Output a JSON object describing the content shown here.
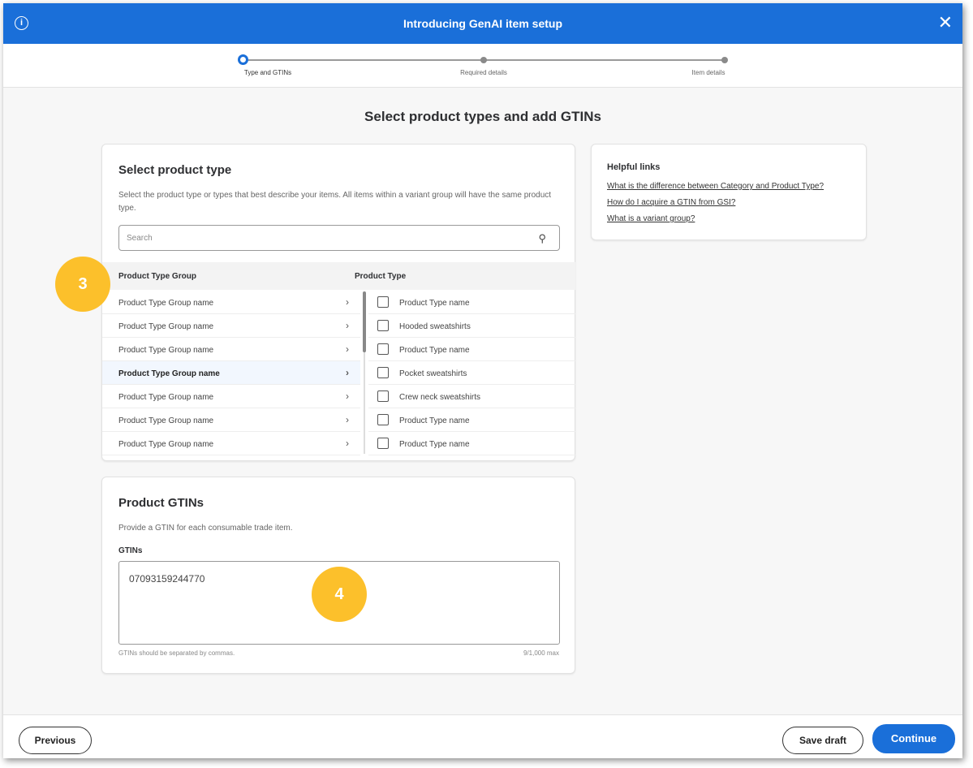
{
  "header": {
    "title": "Introducing GenAI item setup",
    "info_icon": "i",
    "close_icon": "✕"
  },
  "steps": [
    {
      "label": "Type and GTINs",
      "active": true
    },
    {
      "label": "Required details",
      "active": false
    },
    {
      "label": "Item details",
      "active": false
    }
  ],
  "page_title": "Select product types and add GTINs",
  "product_type": {
    "title": "Select product type",
    "description": "Select the product type or types that best describe your items. All items within a variant group will have the same product type.",
    "search_placeholder": "Search",
    "col_group": "Product Type Group",
    "col_type": "Product Type",
    "groups": [
      "Product Type Group name",
      "Product Type Group name",
      "Product Type Group name",
      "Product Type Group name",
      "Product Type Group name",
      "Product Type Group name",
      "Product Type Group name"
    ],
    "selected_group_index": 3,
    "types": [
      "Product Type name",
      "Hooded sweatshirts",
      "Product Type name",
      "Pocket sweatshirts",
      "Crew neck sweatshirts",
      "Product Type name",
      "Product Type name"
    ]
  },
  "helpful": {
    "title": "Helpful links",
    "links": [
      "What is the difference between Category and Product Type?",
      "How do I acquire a GTIN from GSI?",
      "What is a variant group?"
    ]
  },
  "gtins": {
    "title": "Product GTINs",
    "description": "Provide a GTIN for each consumable trade item.",
    "label": "GTINs",
    "value": "07093159244770",
    "hint": "GTINs should be separated by commas.",
    "count": "9/1,000 max"
  },
  "badges": [
    "3",
    "4"
  ],
  "footer": {
    "previous": "Previous",
    "save_draft": "Save draft",
    "continue": "Continue"
  }
}
